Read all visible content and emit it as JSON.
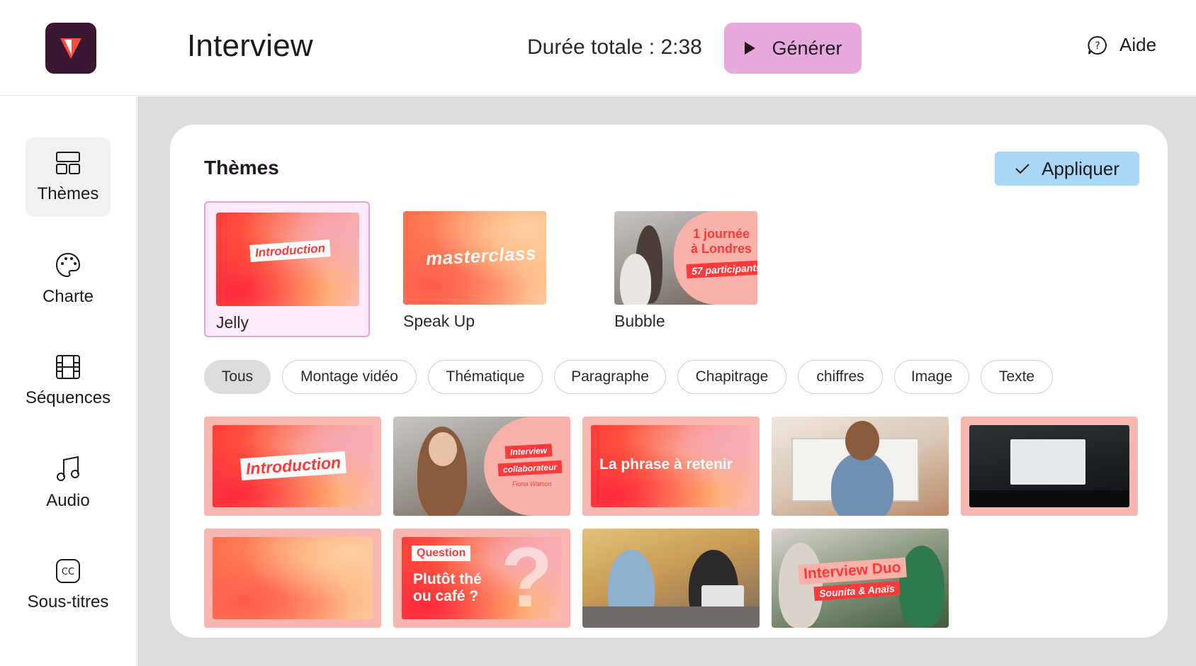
{
  "header": {
    "title": "Interview",
    "duration": "Durée totale : 2:38",
    "generate_label": "Générer",
    "help_label": "Aide"
  },
  "sidebar": {
    "items": [
      {
        "label": "Thèmes",
        "icon": "layout-icon",
        "active": true
      },
      {
        "label": "Charte",
        "icon": "palette-icon",
        "active": false
      },
      {
        "label": "Séquences",
        "icon": "film-icon",
        "active": false
      },
      {
        "label": "Audio",
        "icon": "music-note-icon",
        "active": false
      },
      {
        "label": "Sous-titres",
        "icon": "closed-captions-icon",
        "active": false
      }
    ]
  },
  "panel": {
    "title": "Thèmes",
    "apply_label": "Appliquer",
    "themes": [
      {
        "name": "Jelly",
        "overlay": "Introduction",
        "selected": true
      },
      {
        "name": "Speak Up",
        "overlay": "masterclass",
        "selected": false
      },
      {
        "name": "Bubble",
        "overlay_line1": "1 journée",
        "overlay_line2": "à Londres",
        "overlay_tag": "57 participants",
        "selected": false
      }
    ],
    "filters": [
      "Tous",
      "Montage vidéo",
      "Thématique",
      "Paragraphe",
      "Chapitrage",
      "chiffres",
      "Image",
      "Texte"
    ],
    "active_filter": "Tous",
    "tiles": {
      "intro": "Introduction",
      "interview_tag": "Interview",
      "collaborateur_tag": "collaborateur",
      "person_name": "Fiona Watson",
      "phrase": "La phrase à retenir",
      "question_tag": "Question",
      "question_line1": "Plutôt thé",
      "question_line2": "ou café ?",
      "question_mark": "?",
      "duo_title": "Interview Duo",
      "duo_names": "Sounita & Anaïs"
    }
  },
  "colors": {
    "logo_bg": "#3b1630",
    "generate_bg": "#e7a9dc",
    "apply_bg": "#a9d8f6",
    "selected_card_bg": "#fce9fa",
    "tile_frame": "#f7b6b0",
    "accent_red": "#ff3a3a"
  }
}
